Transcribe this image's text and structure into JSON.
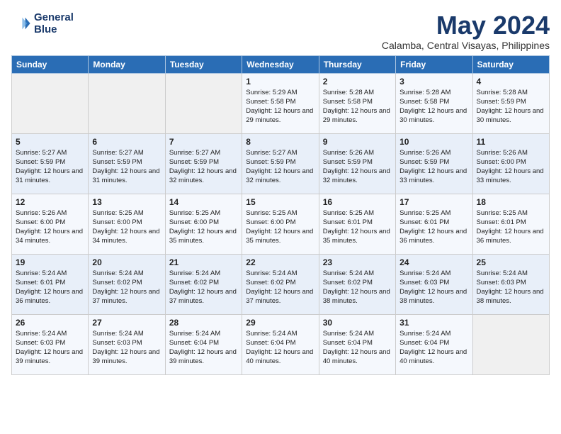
{
  "header": {
    "logo_line1": "General",
    "logo_line2": "Blue",
    "month_title": "May 2024",
    "location": "Calamba, Central Visayas, Philippines"
  },
  "days_of_week": [
    "Sunday",
    "Monday",
    "Tuesday",
    "Wednesday",
    "Thursday",
    "Friday",
    "Saturday"
  ],
  "weeks": [
    [
      {
        "day": "",
        "sunrise": "",
        "sunset": "",
        "daylight": ""
      },
      {
        "day": "",
        "sunrise": "",
        "sunset": "",
        "daylight": ""
      },
      {
        "day": "",
        "sunrise": "",
        "sunset": "",
        "daylight": ""
      },
      {
        "day": "1",
        "sunrise": "Sunrise: 5:29 AM",
        "sunset": "Sunset: 5:58 PM",
        "daylight": "Daylight: 12 hours and 29 minutes."
      },
      {
        "day": "2",
        "sunrise": "Sunrise: 5:28 AM",
        "sunset": "Sunset: 5:58 PM",
        "daylight": "Daylight: 12 hours and 29 minutes."
      },
      {
        "day": "3",
        "sunrise": "Sunrise: 5:28 AM",
        "sunset": "Sunset: 5:58 PM",
        "daylight": "Daylight: 12 hours and 30 minutes."
      },
      {
        "day": "4",
        "sunrise": "Sunrise: 5:28 AM",
        "sunset": "Sunset: 5:59 PM",
        "daylight": "Daylight: 12 hours and 30 minutes."
      }
    ],
    [
      {
        "day": "5",
        "sunrise": "Sunrise: 5:27 AM",
        "sunset": "Sunset: 5:59 PM",
        "daylight": "Daylight: 12 hours and 31 minutes."
      },
      {
        "day": "6",
        "sunrise": "Sunrise: 5:27 AM",
        "sunset": "Sunset: 5:59 PM",
        "daylight": "Daylight: 12 hours and 31 minutes."
      },
      {
        "day": "7",
        "sunrise": "Sunrise: 5:27 AM",
        "sunset": "Sunset: 5:59 PM",
        "daylight": "Daylight: 12 hours and 32 minutes."
      },
      {
        "day": "8",
        "sunrise": "Sunrise: 5:27 AM",
        "sunset": "Sunset: 5:59 PM",
        "daylight": "Daylight: 12 hours and 32 minutes."
      },
      {
        "day": "9",
        "sunrise": "Sunrise: 5:26 AM",
        "sunset": "Sunset: 5:59 PM",
        "daylight": "Daylight: 12 hours and 32 minutes."
      },
      {
        "day": "10",
        "sunrise": "Sunrise: 5:26 AM",
        "sunset": "Sunset: 5:59 PM",
        "daylight": "Daylight: 12 hours and 33 minutes."
      },
      {
        "day": "11",
        "sunrise": "Sunrise: 5:26 AM",
        "sunset": "Sunset: 6:00 PM",
        "daylight": "Daylight: 12 hours and 33 minutes."
      }
    ],
    [
      {
        "day": "12",
        "sunrise": "Sunrise: 5:26 AM",
        "sunset": "Sunset: 6:00 PM",
        "daylight": "Daylight: 12 hours and 34 minutes."
      },
      {
        "day": "13",
        "sunrise": "Sunrise: 5:25 AM",
        "sunset": "Sunset: 6:00 PM",
        "daylight": "Daylight: 12 hours and 34 minutes."
      },
      {
        "day": "14",
        "sunrise": "Sunrise: 5:25 AM",
        "sunset": "Sunset: 6:00 PM",
        "daylight": "Daylight: 12 hours and 35 minutes."
      },
      {
        "day": "15",
        "sunrise": "Sunrise: 5:25 AM",
        "sunset": "Sunset: 6:00 PM",
        "daylight": "Daylight: 12 hours and 35 minutes."
      },
      {
        "day": "16",
        "sunrise": "Sunrise: 5:25 AM",
        "sunset": "Sunset: 6:01 PM",
        "daylight": "Daylight: 12 hours and 35 minutes."
      },
      {
        "day": "17",
        "sunrise": "Sunrise: 5:25 AM",
        "sunset": "Sunset: 6:01 PM",
        "daylight": "Daylight: 12 hours and 36 minutes."
      },
      {
        "day": "18",
        "sunrise": "Sunrise: 5:25 AM",
        "sunset": "Sunset: 6:01 PM",
        "daylight": "Daylight: 12 hours and 36 minutes."
      }
    ],
    [
      {
        "day": "19",
        "sunrise": "Sunrise: 5:24 AM",
        "sunset": "Sunset: 6:01 PM",
        "daylight": "Daylight: 12 hours and 36 minutes."
      },
      {
        "day": "20",
        "sunrise": "Sunrise: 5:24 AM",
        "sunset": "Sunset: 6:02 PM",
        "daylight": "Daylight: 12 hours and 37 minutes."
      },
      {
        "day": "21",
        "sunrise": "Sunrise: 5:24 AM",
        "sunset": "Sunset: 6:02 PM",
        "daylight": "Daylight: 12 hours and 37 minutes."
      },
      {
        "day": "22",
        "sunrise": "Sunrise: 5:24 AM",
        "sunset": "Sunset: 6:02 PM",
        "daylight": "Daylight: 12 hours and 37 minutes."
      },
      {
        "day": "23",
        "sunrise": "Sunrise: 5:24 AM",
        "sunset": "Sunset: 6:02 PM",
        "daylight": "Daylight: 12 hours and 38 minutes."
      },
      {
        "day": "24",
        "sunrise": "Sunrise: 5:24 AM",
        "sunset": "Sunset: 6:03 PM",
        "daylight": "Daylight: 12 hours and 38 minutes."
      },
      {
        "day": "25",
        "sunrise": "Sunrise: 5:24 AM",
        "sunset": "Sunset: 6:03 PM",
        "daylight": "Daylight: 12 hours and 38 minutes."
      }
    ],
    [
      {
        "day": "26",
        "sunrise": "Sunrise: 5:24 AM",
        "sunset": "Sunset: 6:03 PM",
        "daylight": "Daylight: 12 hours and 39 minutes."
      },
      {
        "day": "27",
        "sunrise": "Sunrise: 5:24 AM",
        "sunset": "Sunset: 6:03 PM",
        "daylight": "Daylight: 12 hours and 39 minutes."
      },
      {
        "day": "28",
        "sunrise": "Sunrise: 5:24 AM",
        "sunset": "Sunset: 6:04 PM",
        "daylight": "Daylight: 12 hours and 39 minutes."
      },
      {
        "day": "29",
        "sunrise": "Sunrise: 5:24 AM",
        "sunset": "Sunset: 6:04 PM",
        "daylight": "Daylight: 12 hours and 40 minutes."
      },
      {
        "day": "30",
        "sunrise": "Sunrise: 5:24 AM",
        "sunset": "Sunset: 6:04 PM",
        "daylight": "Daylight: 12 hours and 40 minutes."
      },
      {
        "day": "31",
        "sunrise": "Sunrise: 5:24 AM",
        "sunset": "Sunset: 6:04 PM",
        "daylight": "Daylight: 12 hours and 40 minutes."
      },
      {
        "day": "",
        "sunrise": "",
        "sunset": "",
        "daylight": ""
      }
    ]
  ]
}
